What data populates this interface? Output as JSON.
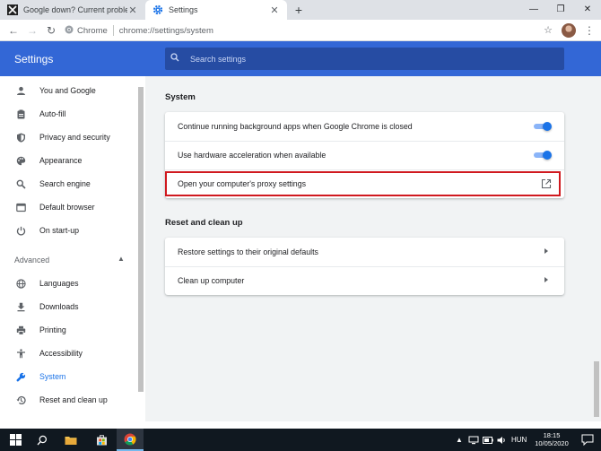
{
  "tabs": [
    {
      "title": "Google down? Current problems",
      "close": "✕"
    },
    {
      "title": "Settings",
      "close": "✕"
    }
  ],
  "new_tab": "+",
  "window_controls": {
    "minimize": "—",
    "restore": "❐",
    "close": "✕"
  },
  "toolbar": {
    "back": "←",
    "forward": "→",
    "reload": "↻",
    "site_chip": "Chrome",
    "url": "chrome://settings/system",
    "star": "☆",
    "menu": "⋮"
  },
  "settings": {
    "title": "Settings",
    "search_placeholder": "Search settings"
  },
  "sidebar": {
    "items": [
      {
        "label": "You and Google",
        "icon": "person-icon"
      },
      {
        "label": "Auto-fill",
        "icon": "clipboard-icon"
      },
      {
        "label": "Privacy and security",
        "icon": "shield-icon"
      },
      {
        "label": "Appearance",
        "icon": "palette-icon"
      },
      {
        "label": "Search engine",
        "icon": "search-icon"
      },
      {
        "label": "Default browser",
        "icon": "browser-icon"
      },
      {
        "label": "On start-up",
        "icon": "power-icon"
      }
    ],
    "advanced_label": "Advanced",
    "advanced_items": [
      {
        "label": "Languages",
        "icon": "globe-icon"
      },
      {
        "label": "Downloads",
        "icon": "download-icon"
      },
      {
        "label": "Printing",
        "icon": "printer-icon"
      },
      {
        "label": "Accessibility",
        "icon": "accessibility-icon"
      },
      {
        "label": "System",
        "icon": "wrench-icon",
        "active": true
      },
      {
        "label": "Reset and clean up",
        "icon": "history-icon"
      }
    ]
  },
  "system": {
    "title": "System",
    "rows": [
      {
        "label": "Continue running background apps when Google Chrome is closed",
        "toggle": true
      },
      {
        "label": "Use hardware acceleration when available",
        "toggle": true
      },
      {
        "label": "Open your computer's proxy settings"
      }
    ]
  },
  "reset": {
    "title": "Reset and clean up",
    "rows": [
      {
        "label": "Restore settings to their original defaults"
      },
      {
        "label": "Clean up computer"
      }
    ]
  },
  "taskbar": {
    "language": "HUN",
    "time": "18:15",
    "date": "10/05/2020"
  },
  "colors": {
    "accent": "#1a73e8",
    "header": "#3367d6",
    "highlight": "#d0191f"
  }
}
